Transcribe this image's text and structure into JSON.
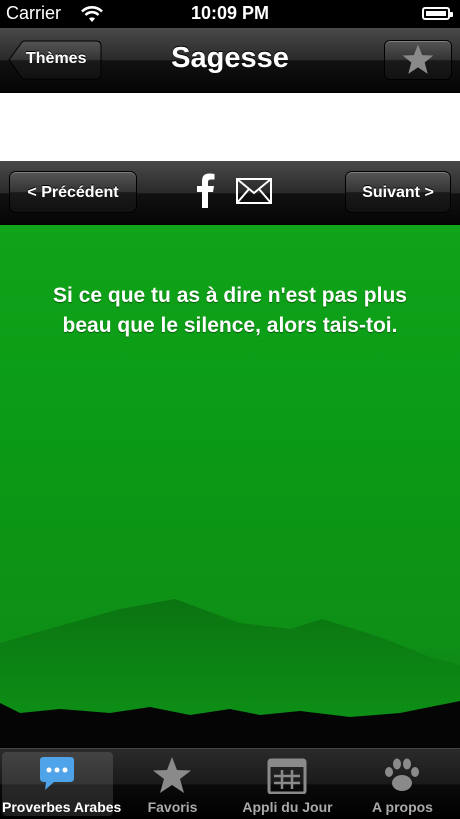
{
  "status_bar": {
    "carrier": "Carrier",
    "time": "10:09 PM"
  },
  "nav": {
    "back_label": "Thèmes",
    "title": "Sagesse",
    "favorite_icon": "star-icon"
  },
  "toolbar": {
    "prev_label": "< Précédent",
    "next_label": "Suivant >",
    "share_icons": [
      "facebook-icon",
      "mail-icon"
    ]
  },
  "quote": {
    "text": "Si ce que tu as à dire n'est pas plus beau que le silence, alors tais-toi."
  },
  "tabs": [
    {
      "label": "Proverbes Arabes",
      "icon": "speech-bubble-icon",
      "active": true
    },
    {
      "label": "Favoris",
      "icon": "star-icon",
      "active": false
    },
    {
      "label": "Appli du Jour",
      "icon": "calendar-icon",
      "active": false
    },
    {
      "label": "A propos",
      "icon": "paw-icon",
      "active": false
    }
  ],
  "colors": {
    "background_green": "#0fa41a",
    "bar_dark": "#111111"
  }
}
